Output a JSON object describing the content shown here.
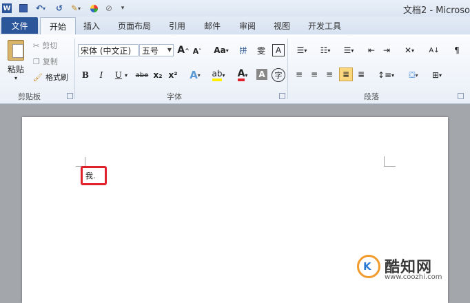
{
  "titlebar": {
    "doc_title": "文档2 - Microso",
    "icons": [
      "word-logo-icon",
      "save-icon",
      "undo-icon",
      "repeat-icon",
      "format-painter-icon",
      "color-icon",
      "draw-icon",
      "customize-icon"
    ]
  },
  "tabs": {
    "file": "文件",
    "items": [
      "开始",
      "插入",
      "页面布局",
      "引用",
      "邮件",
      "审阅",
      "视图",
      "开发工具"
    ]
  },
  "ribbon": {
    "clipboard": {
      "paste": "粘贴",
      "cut": "剪切",
      "copy": "复制",
      "format_painter": "格式刷",
      "group": "剪贴板"
    },
    "font": {
      "font_name": "宋体 (中文正)",
      "font_size": "五号",
      "grow": "A",
      "shrink": "A",
      "change_case": "Aa",
      "bold": "B",
      "italic": "I",
      "underline": "U",
      "strike": "abe",
      "subscript": "x₂",
      "superscript": "x²",
      "group": "字体"
    },
    "paragraph": {
      "group": "段落"
    }
  },
  "document": {
    "text": "我."
  },
  "watermark": {
    "name": "酷知网",
    "url": "www.coozhi.com",
    "logo_letter": "K"
  },
  "colors": {
    "file_tab": "#2b579a",
    "highlight_box": "#e0212b",
    "watermark_orange": "#f29b2c"
  }
}
